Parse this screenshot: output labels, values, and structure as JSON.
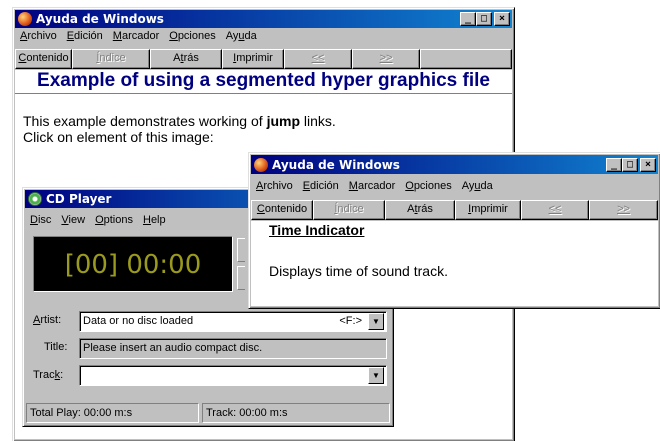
{
  "main_window": {
    "title": "Ayuda de Windows",
    "menu": [
      "Archivo",
      "Edición",
      "Marcador",
      "Opciones",
      "Ayuda"
    ],
    "buttons": [
      "Contenido",
      "Índice",
      "Atrás",
      "Imprimir",
      "<<",
      ">>"
    ],
    "disabled_buttons": [
      "Índice",
      "<<",
      ">>"
    ],
    "heading": "Example of using a segmented hyper graphics file",
    "text_line1_pre": "This example demonstrates working of ",
    "text_line1_bold": "jump",
    "text_line1_post": " links.",
    "text_line2": "Click on element of this image:"
  },
  "cd_player": {
    "title": "CD Player",
    "menu": [
      "Disc",
      "View",
      "Options",
      "Help"
    ],
    "display": "[00] 00:00",
    "artist_label": "Artist:",
    "artist_value": "Data or no disc loaded",
    "drive": "<F:>",
    "title_label": "Title:",
    "title_value": "Please insert an audio compact disc.",
    "track_label": "Track:",
    "track_value": "",
    "status_total": "Total Play: 00:00 m:s",
    "status_track": "Track: 00:00 m:s"
  },
  "popup_window": {
    "title": "Ayuda de Windows",
    "menu": [
      "Archivo",
      "Edición",
      "Marcador",
      "Opciones",
      "Ayuda"
    ],
    "buttons": [
      "Contenido",
      "Índice",
      "Atrás",
      "Imprimir",
      "<<",
      ">>"
    ],
    "heading": "Time Indicator",
    "body": "Displays time of sound track."
  },
  "colors": {
    "title_gradient_start": "#000080",
    "title_gradient_end": "#1084d0",
    "heading_blue": "#000080",
    "led_text": "#9a9a1e",
    "window_face": "#c0c0c0"
  },
  "icons": {
    "help_app": "help-book-icon",
    "cd_app": "cd-disc-icon",
    "minimize": "minimize-icon",
    "maximize": "maximize-icon",
    "close": "close-icon",
    "dropdown": "chevron-down-icon"
  }
}
